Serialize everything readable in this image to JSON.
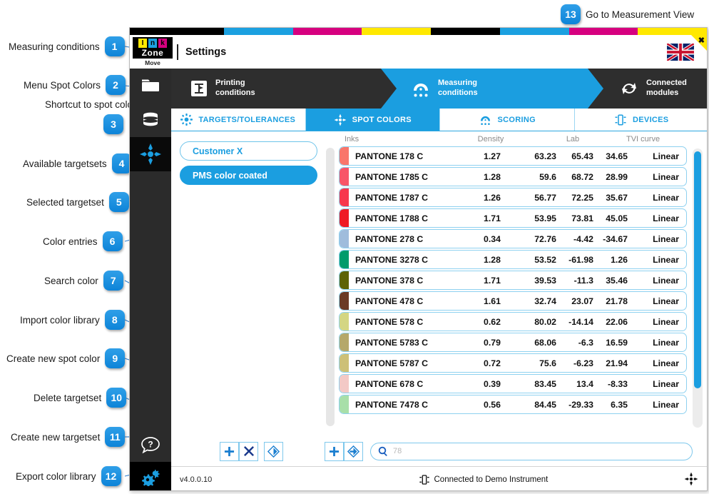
{
  "callouts": [
    {
      "n": "1",
      "label": "Measuring conditions"
    },
    {
      "n": "2",
      "label": "Menu Spot Colors"
    },
    {
      "n": "3",
      "label": "Shortcut to spot color"
    },
    {
      "n": "4",
      "label": "Available targetsets"
    },
    {
      "n": "5",
      "label": "Selected targetset"
    },
    {
      "n": "6",
      "label": "Color entries"
    },
    {
      "n": "7",
      "label": "Search color"
    },
    {
      "n": "8",
      "label": "Import color library"
    },
    {
      "n": "9",
      "label": "Create new spot color"
    },
    {
      "n": "10",
      "label": "Delete targetset"
    },
    {
      "n": "11",
      "label": "Create new targetset"
    },
    {
      "n": "12",
      "label": "Export color library"
    },
    {
      "n": "13",
      "label": "Go to Measurement View"
    }
  ],
  "window": {
    "logo": {
      "letters": [
        "I",
        "n",
        "k"
      ],
      "wordmark": "Zone",
      "subtitle": "Move"
    },
    "title": "Settings",
    "language_flag": "uk-flag-icon",
    "close_label": "✖"
  },
  "topbar_colors": [
    "#000000",
    "#1ba0e0",
    "#d6007f",
    "#ffe800",
    "#000000",
    "#1ba0e0",
    "#d6007f",
    "#ffe800"
  ],
  "sidebar": {
    "items": [
      {
        "icon": "folder-icon",
        "name": "jobs"
      },
      {
        "icon": "database-icon",
        "name": "database"
      },
      {
        "icon": "spot-color-target-icon",
        "name": "spot-colors",
        "selected": true
      },
      {
        "icon": "help-icon",
        "name": "help"
      },
      {
        "icon": "gear-icon",
        "name": "settings"
      }
    ]
  },
  "breadcrumbs": [
    {
      "label_line1": "Printing",
      "label_line2": "conditions",
      "icon": "printing-conditions-icon",
      "active": false
    },
    {
      "label_line1": "Measuring",
      "label_line2": "conditions",
      "icon": "measuring-conditions-icon",
      "active": true
    },
    {
      "label_line1": "Connected",
      "label_line2": "modules",
      "icon": "connected-modules-icon",
      "active": false
    }
  ],
  "tabs": [
    {
      "label": "TARGETS/TOLERANCES",
      "icon": "targets-tolerances-icon",
      "active": false
    },
    {
      "label": "SPOT COLORS",
      "icon": "spot-colors-icon",
      "active": true
    },
    {
      "label": "SCORING",
      "icon": "scoring-icon",
      "active": false
    },
    {
      "label": "DEVICES",
      "icon": "devices-icon",
      "active": false
    }
  ],
  "targetsets": [
    {
      "label": "Customer X",
      "selected": false
    },
    {
      "label": "PMS color coated",
      "selected": true
    }
  ],
  "table": {
    "headers": {
      "inks": "Inks",
      "density": "Density",
      "lab": "Lab",
      "tvi": "TVI curve"
    },
    "rows": [
      {
        "name": "PANTONE 178 C",
        "swatch": "#f9766b",
        "density": "1.27",
        "L": "63.23",
        "a": "65.43",
        "b": "34.65",
        "tvi": "Linear"
      },
      {
        "name": "PANTONE 1785 C",
        "swatch": "#f85568",
        "density": "1.28",
        "L": "59.6",
        "a": "68.72",
        "b": "28.99",
        "tvi": "Linear"
      },
      {
        "name": "PANTONE 1787 C",
        "swatch": "#f7374d",
        "density": "1.26",
        "L": "56.77",
        "a": "72.25",
        "b": "35.67",
        "tvi": "Linear"
      },
      {
        "name": "PANTONE 1788 C",
        "swatch": "#ef1b24",
        "density": "1.71",
        "L": "53.95",
        "a": "73.81",
        "b": "45.05",
        "tvi": "Linear"
      },
      {
        "name": "PANTONE 278 C",
        "swatch": "#9fbcdc",
        "density": "0.34",
        "L": "72.76",
        "a": "-4.42",
        "b": "-34.67",
        "tvi": "Linear"
      },
      {
        "name": "PANTONE 3278 C",
        "swatch": "#009b6b",
        "density": "1.28",
        "L": "53.52",
        "a": "-61.98",
        "b": "1.26",
        "tvi": "Linear"
      },
      {
        "name": "PANTONE 378 C",
        "swatch": "#5d6306",
        "density": "1.71",
        "L": "39.53",
        "a": "-11.3",
        "b": "35.46",
        "tvi": "Linear"
      },
      {
        "name": "PANTONE 478 C",
        "swatch": "#6b3a25",
        "density": "1.61",
        "L": "32.74",
        "a": "23.07",
        "b": "21.78",
        "tvi": "Linear"
      },
      {
        "name": "PANTONE 578 C",
        "swatch": "#d4d683",
        "density": "0.62",
        "L": "80.02",
        "a": "-14.14",
        "b": "22.06",
        "tvi": "Linear"
      },
      {
        "name": "PANTONE 5783 C",
        "swatch": "#b5a86a",
        "density": "0.79",
        "L": "68.06",
        "a": "-6.3",
        "b": "16.59",
        "tvi": "Linear"
      },
      {
        "name": "PANTONE 5787 C",
        "swatch": "#cdc077",
        "density": "0.72",
        "L": "75.6",
        "a": "-6.23",
        "b": "21.94",
        "tvi": "Linear"
      },
      {
        "name": "PANTONE 678 C",
        "swatch": "#f3c9c6",
        "density": "0.39",
        "L": "83.45",
        "a": "13.4",
        "b": "-8.33",
        "tvi": "Linear"
      },
      {
        "name": "PANTONE 7478 C",
        "swatch": "#a8dfa9",
        "density": "0.56",
        "L": "84.45",
        "a": "-29.33",
        "b": "6.35",
        "tvi": "Linear"
      }
    ]
  },
  "toolbar": {
    "new_targetset_icon": "plus-icon",
    "delete_targetset_icon": "cross-icon",
    "export_library_icon": "export-icon",
    "new_spot_color_icon": "plus-icon",
    "import_library_icon": "import-icon",
    "search_icon": "search-icon",
    "search_value": "78"
  },
  "status": {
    "version": "v4.0.0.10",
    "connection": "Connected to Demo Instrument",
    "connection_icon": "instrument-icon",
    "right_icon": "spot-color-target-icon"
  },
  "accent": "#1b9ee0"
}
